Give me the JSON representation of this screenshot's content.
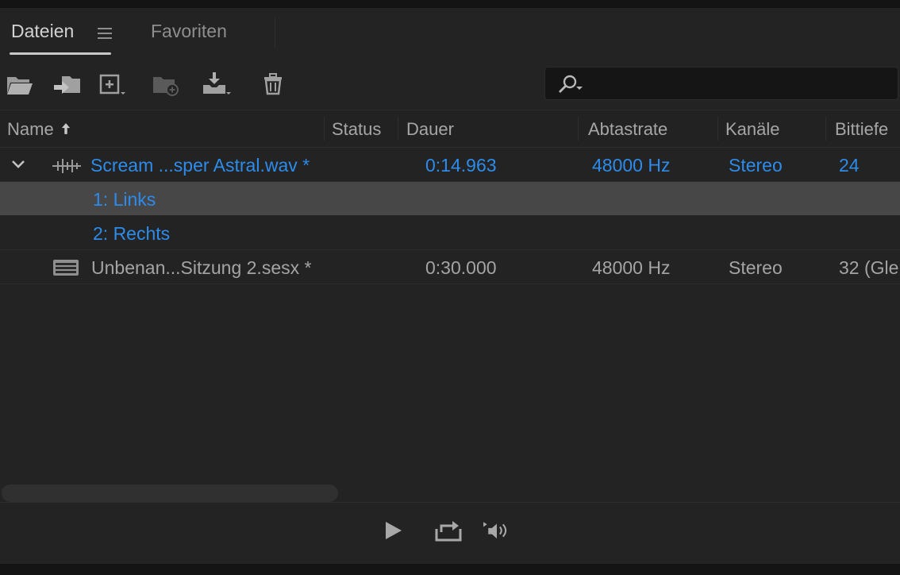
{
  "tabs": [
    {
      "label": "Dateien",
      "active": true
    },
    {
      "label": "Favoriten",
      "active": false
    }
  ],
  "toolbar": {
    "icons": [
      "open-folder-icon",
      "import-icon",
      "new-file-icon",
      "insert-folder-icon",
      "export-icon",
      "trash-icon"
    ]
  },
  "search": {
    "placeholder": "",
    "value": ""
  },
  "columns": {
    "name": "Name",
    "status": "Status",
    "dauer": "Dauer",
    "abtastrate": "Abtastrate",
    "kanaele": "Kanäle",
    "bittiefe": "Bittiefe"
  },
  "files": [
    {
      "name": "Scream ...sper Astral.wav *",
      "status": "",
      "dauer": "0:14.963",
      "abtastrate": "48000 Hz",
      "kanaele": "Stereo",
      "bittiefe": "24",
      "expanded": true,
      "channels": [
        "1: Links",
        "2: Rechts"
      ]
    },
    {
      "name": "Unbenan...Sitzung 2.sesx *",
      "status": "",
      "dauer": "0:30.000",
      "abtastrate": "48000 Hz",
      "kanaele": "Stereo",
      "bittiefe": "32 (Gle"
    }
  ],
  "colors": {
    "accent_blue": "#2d8ceb",
    "panel_bg": "#232323",
    "selected_row": "#474747"
  }
}
